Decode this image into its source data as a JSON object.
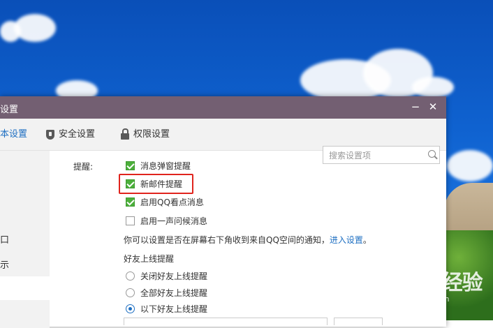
{
  "window": {
    "title": "设置",
    "minimize": "−",
    "close": "✕"
  },
  "tabs": [
    {
      "label": "本设置",
      "active": true
    },
    {
      "label": "安全设置",
      "icon": "shield-icon"
    },
    {
      "label": "权限设置",
      "icon": "lock-icon"
    }
  ],
  "search": {
    "placeholder": "搜索设置项"
  },
  "sidebar": {
    "items": [
      "口",
      "示"
    ]
  },
  "reminders": {
    "label": "提醒:",
    "options": [
      {
        "label": "消息弹窗提醒",
        "checked": true
      },
      {
        "label": "新邮件提醒",
        "checked": true,
        "highlighted": true
      },
      {
        "label": "启用QQ看点消息",
        "checked": true
      },
      {
        "label": "启用一声问候消息",
        "checked": false
      }
    ]
  },
  "notice": {
    "text": "你可以设置是否在屏幕右下角收到来自QQ空间的通知，",
    "link": "进入设置",
    "end": "。"
  },
  "friend_online": {
    "heading": "好友上线提醒",
    "options": [
      {
        "label": "关闭好友上线提醒",
        "selected": false
      },
      {
        "label": "全部好友上线提醒",
        "selected": false
      },
      {
        "label": "以下好友上线提醒",
        "selected": true
      }
    ]
  },
  "watermark": {
    "logo": "Baidu 经验",
    "sub": "jingyan.baidu.com"
  },
  "colors": {
    "titlebar": "#735f72",
    "accent": "#1e6fc2",
    "checkbox": "#4caf3b",
    "highlight": "#e0241d"
  }
}
